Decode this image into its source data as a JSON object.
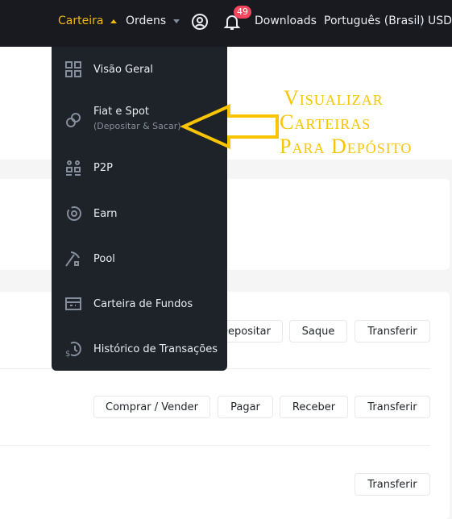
{
  "header": {
    "wallet": "Carteira",
    "orders": "Ordens",
    "notifications_count": "49",
    "downloads": "Downloads",
    "language": "Português (Brasil)",
    "currency": "USD",
    "accent": "#f0b90b"
  },
  "menu": {
    "items": [
      {
        "label": "Visão Geral",
        "icon": "grid-icon"
      },
      {
        "label": "Fiat e Spot",
        "sub": "(Depositar & Sacar)",
        "icon": "fiat-spot-icon"
      },
      {
        "label": "P2P",
        "icon": "p2p-icon"
      },
      {
        "label": "Earn",
        "icon": "earn-icon"
      },
      {
        "label": "Pool",
        "icon": "pickaxe-icon"
      },
      {
        "label": "Carteira de Fundos",
        "icon": "card-icon"
      },
      {
        "label": "Histórico de Transações",
        "icon": "history-icon"
      }
    ]
  },
  "rows": [
    {
      "buttons": [
        "Depositar",
        "Saque",
        "Transferir"
      ]
    },
    {
      "buttons": [
        "Comprar / Vender",
        "Pagar",
        "Receber",
        "Transferir"
      ]
    },
    {
      "buttons": [
        "Transferir"
      ]
    }
  ],
  "annotation": {
    "lines": [
      "Visualizar",
      "Carteiras",
      "Para Depósito"
    ],
    "color": "#f8c500"
  }
}
